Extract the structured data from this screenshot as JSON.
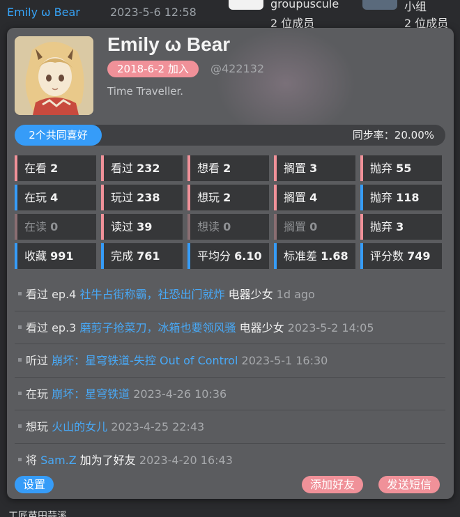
{
  "background": {
    "username": "Emily ω Bear",
    "timestamp": "2023-5-6 12:58",
    "groups": [
      {
        "name": "groupuscule",
        "members": "2 位成员"
      },
      {
        "name": "小组",
        "members": "2 位成员"
      }
    ],
    "bottom_text": "工匠苗田蒜溪"
  },
  "profile": {
    "name": "Emily ω Bear",
    "join_badge": "2018-6-2 加入",
    "uid": "@422132",
    "sign": "Time Traveller."
  },
  "sync": {
    "common_likes": "2个共同喜好",
    "rate_text": "同步率：20.00%"
  },
  "stats": [
    {
      "label": "在看",
      "value": "2",
      "accent": "pink",
      "dim": false
    },
    {
      "label": "看过",
      "value": "232",
      "accent": "pink",
      "dim": false
    },
    {
      "label": "想看",
      "value": "2",
      "accent": "pink",
      "dim": false
    },
    {
      "label": "搁置",
      "value": "3",
      "accent": "pink",
      "dim": false
    },
    {
      "label": "抛弃",
      "value": "55",
      "accent": "pink",
      "dim": false
    },
    {
      "label": "在玩",
      "value": "4",
      "accent": "blue",
      "dim": false
    },
    {
      "label": "玩过",
      "value": "238",
      "accent": "pink",
      "dim": false
    },
    {
      "label": "想玩",
      "value": "2",
      "accent": "pink",
      "dim": false
    },
    {
      "label": "搁置",
      "value": "4",
      "accent": "pink",
      "dim": false
    },
    {
      "label": "抛弃",
      "value": "118",
      "accent": "blue",
      "dim": false
    },
    {
      "label": "在读",
      "value": "0",
      "accent": "pink",
      "dim": true
    },
    {
      "label": "读过",
      "value": "39",
      "accent": "pink",
      "dim": false
    },
    {
      "label": "想读",
      "value": "0",
      "accent": "pink",
      "dim": true
    },
    {
      "label": "搁置",
      "value": "0",
      "accent": "pink",
      "dim": true
    },
    {
      "label": "抛弃",
      "value": "3",
      "accent": "pink",
      "dim": false
    },
    {
      "label": "收藏",
      "value": "991",
      "accent": "blue",
      "dim": false
    },
    {
      "label": "完成",
      "value": "761",
      "accent": "blue",
      "dim": false
    },
    {
      "label": "平均分",
      "value": "6.10",
      "accent": "blue",
      "dim": false
    },
    {
      "label": "标准差",
      "value": "1.68",
      "accent": "blue",
      "dim": false
    },
    {
      "label": "评分数",
      "value": "749",
      "accent": "blue",
      "dim": false
    }
  ],
  "timeline": [
    {
      "action": "看过 ep.4",
      "link": "社牛占街称霸，社恐出门就炸",
      "extra": "电器少女",
      "time": "1d ago"
    },
    {
      "action": "看过 ep.3",
      "link": "磨剪子抢菜刀，冰箱也要领风骚",
      "extra": "电器少女",
      "time": "2023-5-2 14:05"
    },
    {
      "action": "听过",
      "link": "崩坏：星穹铁道-失控 Out of Control",
      "extra": "",
      "time": "2023-5-1 16:30"
    },
    {
      "action": "在玩",
      "link": "崩坏：星穹铁道",
      "extra": "",
      "time": "2023-4-26 10:36"
    },
    {
      "action": "想玩",
      "link": "火山的女儿",
      "extra": "",
      "time": "2023-4-25 22:43"
    },
    {
      "action": "将",
      "link": "Sam.Z",
      "extra": "加为了好友",
      "time": "2023-4-20 16:43"
    }
  ],
  "buttons": {
    "settings": "设置",
    "add_friend": "添加好友",
    "send_message": "发送短信"
  },
  "colors": {
    "accent_blue": "#369cf8",
    "accent_pink": "#f09199",
    "card_bg": "#5b5c5f"
  }
}
